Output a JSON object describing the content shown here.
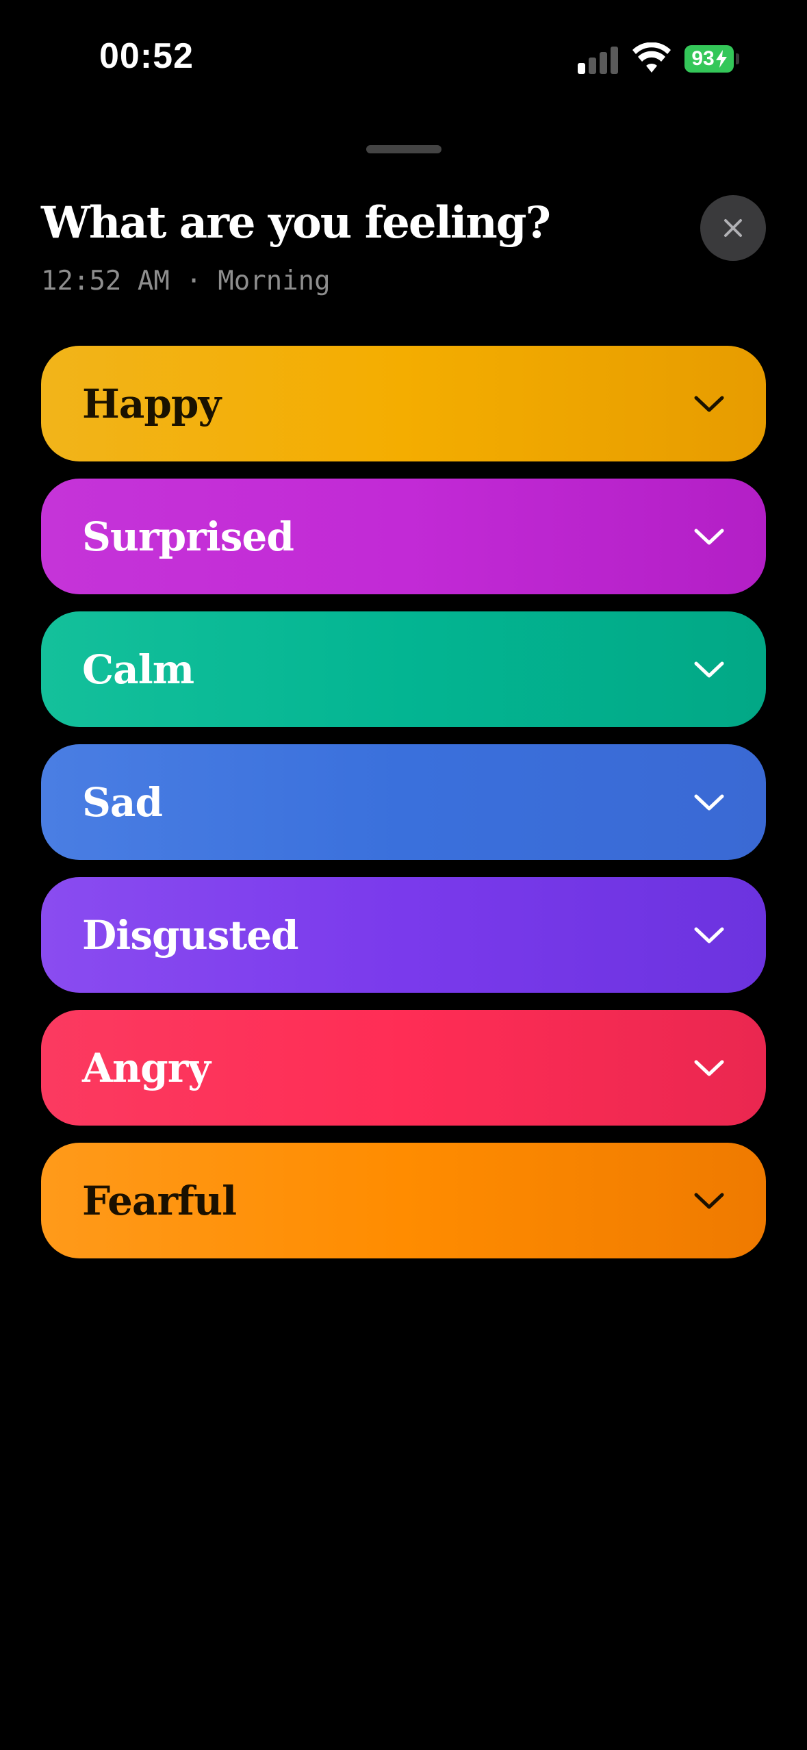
{
  "status_bar": {
    "time": "00:52",
    "battery": "93"
  },
  "sheet": {
    "title": "What are you feeling?",
    "subtitle": "12:52 AM · Morning",
    "close_icon": "close-icon"
  },
  "emotions": [
    {
      "label": "Happy",
      "text_color": "#1a1200",
      "gradient": [
        "#f2b41a",
        "#f4ad00",
        "#e79c00"
      ]
    },
    {
      "label": "Surprised",
      "text_color": "#ffffff",
      "gradient": [
        "#c534d8",
        "#c22ad6",
        "#b31fc6"
      ]
    },
    {
      "label": "Calm",
      "text_color": "#ffffff",
      "gradient": [
        "#14c09b",
        "#03b592",
        "#02a886"
      ]
    },
    {
      "label": "Sad",
      "text_color": "#ffffff",
      "gradient": [
        "#4a7ee3",
        "#3a70dc",
        "#3a69d4"
      ]
    },
    {
      "label": "Disgusted",
      "text_color": "#ffffff",
      "gradient": [
        "#8a4cf0",
        "#7a3aec",
        "#6c33df"
      ]
    },
    {
      "label": "Angry",
      "text_color": "#ffffff",
      "gradient": [
        "#fb3a60",
        "#ff2d55",
        "#ea2750"
      ]
    },
    {
      "label": "Fearful",
      "text_color": "#1a1000",
      "gradient": [
        "#ff9a1a",
        "#ff8c00",
        "#ef7a00"
      ]
    }
  ]
}
